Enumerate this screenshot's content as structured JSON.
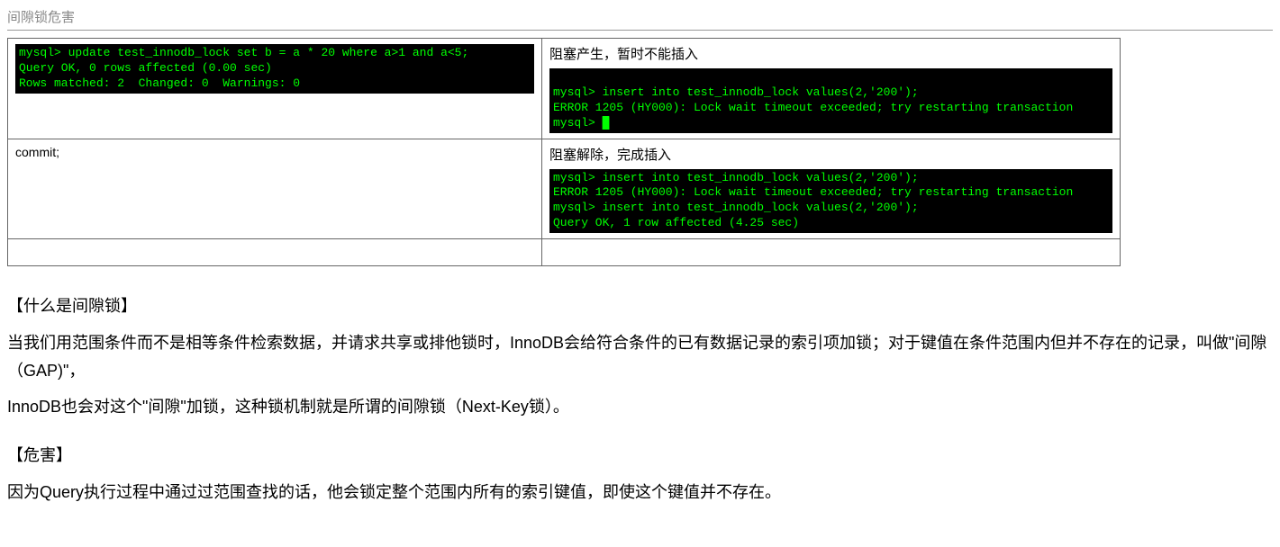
{
  "title": "间隙锁危害",
  "table": {
    "row1": {
      "left_terminal": "mysql> update test_innodb_lock set b = a * 20 where a>1 and a<5;\nQuery OK, 0 rows affected (0.00 sec)\nRows matched: 2  Changed: 0  Warnings: 0",
      "right_label": "阻塞产生，暂时不能插入",
      "right_terminal_pre": "\nmysql> insert into test_innodb_lock values(2,'200');\nERROR 1205 (HY000): Lock wait timeout exceeded; try restarting transaction\nmysql> ",
      "right_cursor": "█"
    },
    "row2": {
      "left_text": "commit;",
      "right_label": "阻塞解除，完成插入",
      "right_terminal": "mysql> insert into test_innodb_lock values(2,'200');\nERROR 1205 (HY000): Lock wait timeout exceeded; try restarting transaction\nmysql> insert into test_innodb_lock values(2,'200');\nQuery OK, 1 row affected (4.25 sec)"
    }
  },
  "sections": {
    "h1": "【什么是间隙锁】",
    "p1": "当我们用范围条件而不是相等条件检索数据，并请求共享或排他锁时，InnoDB会给符合条件的已有数据记录的索引项加锁；对于键值在条件范围内但并不存在的记录，叫做\"间隙（GAP)\"，",
    "p2": "InnoDB也会对这个\"间隙\"加锁，这种锁机制就是所谓的间隙锁（Next-Key锁）。",
    "h2": "【危害】",
    "p3": "因为Query执行过程中通过过范围查找的话，他会锁定整个范围内所有的索引键值，即使这个键值并不存在。"
  }
}
